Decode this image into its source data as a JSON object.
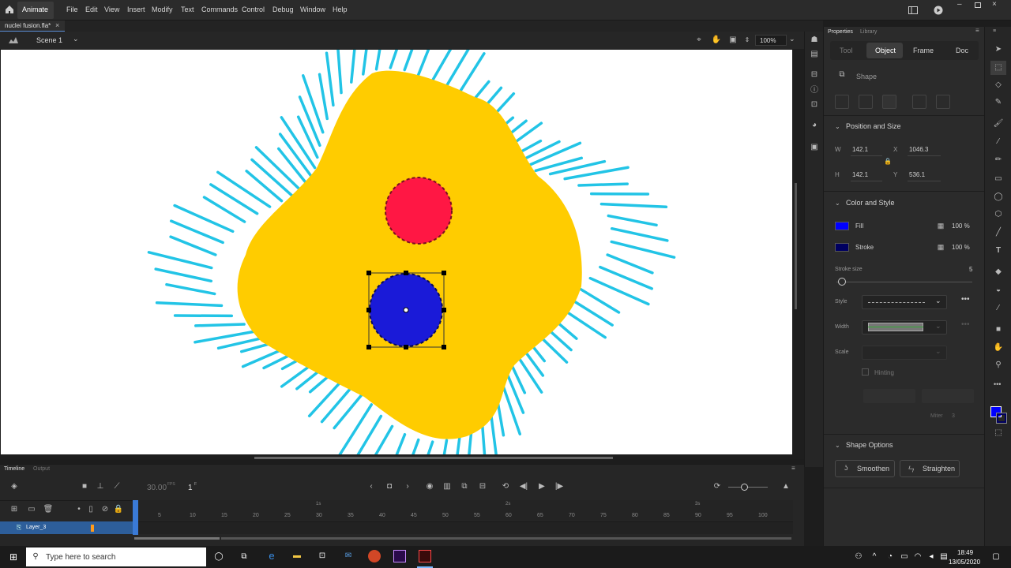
{
  "app": {
    "name": "Animate",
    "menu": [
      "File",
      "Edit",
      "View",
      "Insert",
      "Modify",
      "Text",
      "Commands",
      "Control",
      "Debug",
      "Window",
      "Help"
    ]
  },
  "document": {
    "tab_title": "nuclei fusion.fla*",
    "close_glyph": "×"
  },
  "scene": {
    "name": "Scene 1",
    "zoom": "100%"
  },
  "properties": {
    "panel_tabs": [
      "Properties",
      "Library"
    ],
    "subtabs": [
      "Tool",
      "Object",
      "Frame",
      "Doc"
    ],
    "active_subtab": "Object",
    "object_type": "Shape",
    "position_size": {
      "title": "Position and Size",
      "w_label": "W",
      "w": "142.1",
      "h_label": "H",
      "h": "142.1",
      "x_label": "X",
      "x": "1046.3",
      "y_label": "Y",
      "y": "536.1"
    },
    "color_style": {
      "title": "Color and Style",
      "fill_label": "Fill",
      "fill_color": "#0000ff",
      "fill_alpha": "100 %",
      "stroke_label": "Stroke",
      "stroke_color": "#000060",
      "stroke_alpha": "100 %",
      "stroke_size_label": "Stroke size",
      "stroke_size": "5",
      "style_label": "Style",
      "width_label": "Width",
      "scale_label": "Scale",
      "hinting_label": "Hinting",
      "miter_label": "Miter",
      "miter": "3"
    },
    "shape_options": {
      "title": "Shape Options",
      "smooth": "Smoothen",
      "straighten": "Straighten"
    }
  },
  "timeline": {
    "tabs": [
      "Timeline",
      "Output"
    ],
    "fps": "30.00",
    "fps_unit": "FPS",
    "frame": "1",
    "frame_unit": "F",
    "layer_name": "Layer_3",
    "frame_ticks": [
      "5",
      "10",
      "15",
      "20",
      "25",
      "30",
      "35",
      "40",
      "45",
      "50",
      "55",
      "60",
      "65",
      "70",
      "75",
      "80",
      "85",
      "90",
      "95",
      "100"
    ],
    "second_marks": [
      "1s",
      "2s",
      "3s"
    ]
  },
  "taskbar": {
    "search_placeholder": "Type here to search",
    "time": "18:49",
    "date": "13/05/2020"
  },
  "stage_colors": {
    "blob": "#ffcc00",
    "spikes": "#22c4e6",
    "red_nucleus": "#ff1744",
    "blue_nucleus": "#1a1ad8"
  }
}
